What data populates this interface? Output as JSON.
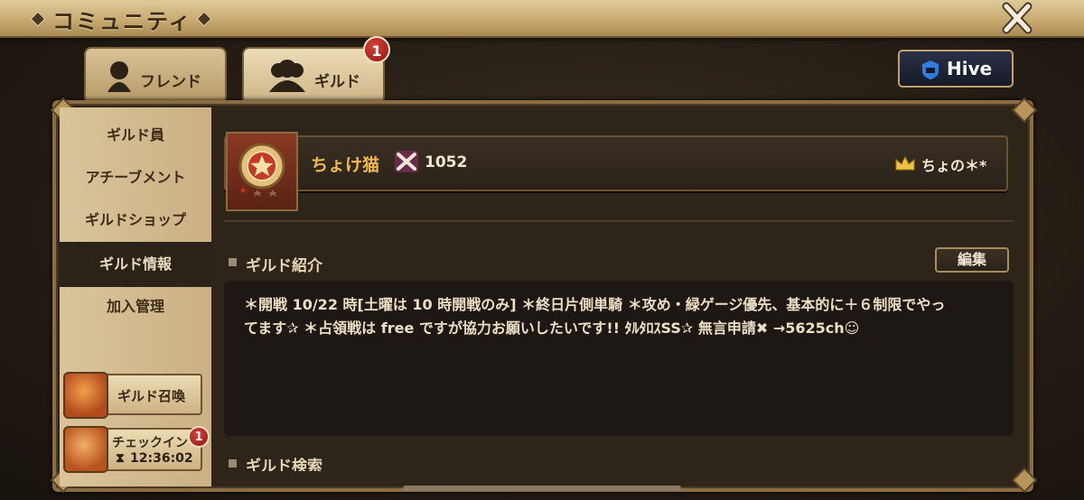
{
  "window": {
    "title": "コミュニティ"
  },
  "tabs": [
    {
      "label": "フレンド"
    },
    {
      "label": "ギルド",
      "badge": "1"
    }
  ],
  "hive": {
    "label": "Hive"
  },
  "sidebar": {
    "items": [
      {
        "label": "ギルド員"
      },
      {
        "label": "アチーブメント"
      },
      {
        "label": "ギルドショップ"
      },
      {
        "label": "ギルド情報",
        "active": true
      },
      {
        "label": "加入管理"
      }
    ],
    "summon": {
      "label": "ギルド召喚"
    },
    "checkin": {
      "label": "チェックイン",
      "timer": "12:36:02",
      "badge": "1"
    }
  },
  "guild": {
    "name": "ちょけ猫",
    "score": "1052",
    "master": "ちょの＊*"
  },
  "intro": {
    "heading": "ギルド紹介",
    "edit_label": "編集",
    "line1": "＊開戦 10/22 時[土曜は 10 時開戦のみ] ＊終日片側単騎 ＊攻め・緑ゲージ優先、基本的に＋６制限でやっ",
    "line2": "てます✰ ＊占領戦は free ですが協力お願いしたいです!! ﾀﾙﾀﾛｽSS✰ 無言申請✖ →5625ch☺"
  },
  "search": {
    "heading": "ギルド検索"
  },
  "colors": {
    "accent": "#f0b94a",
    "badge_red": "#c0302a",
    "frame_gold": "#8c6d41"
  }
}
